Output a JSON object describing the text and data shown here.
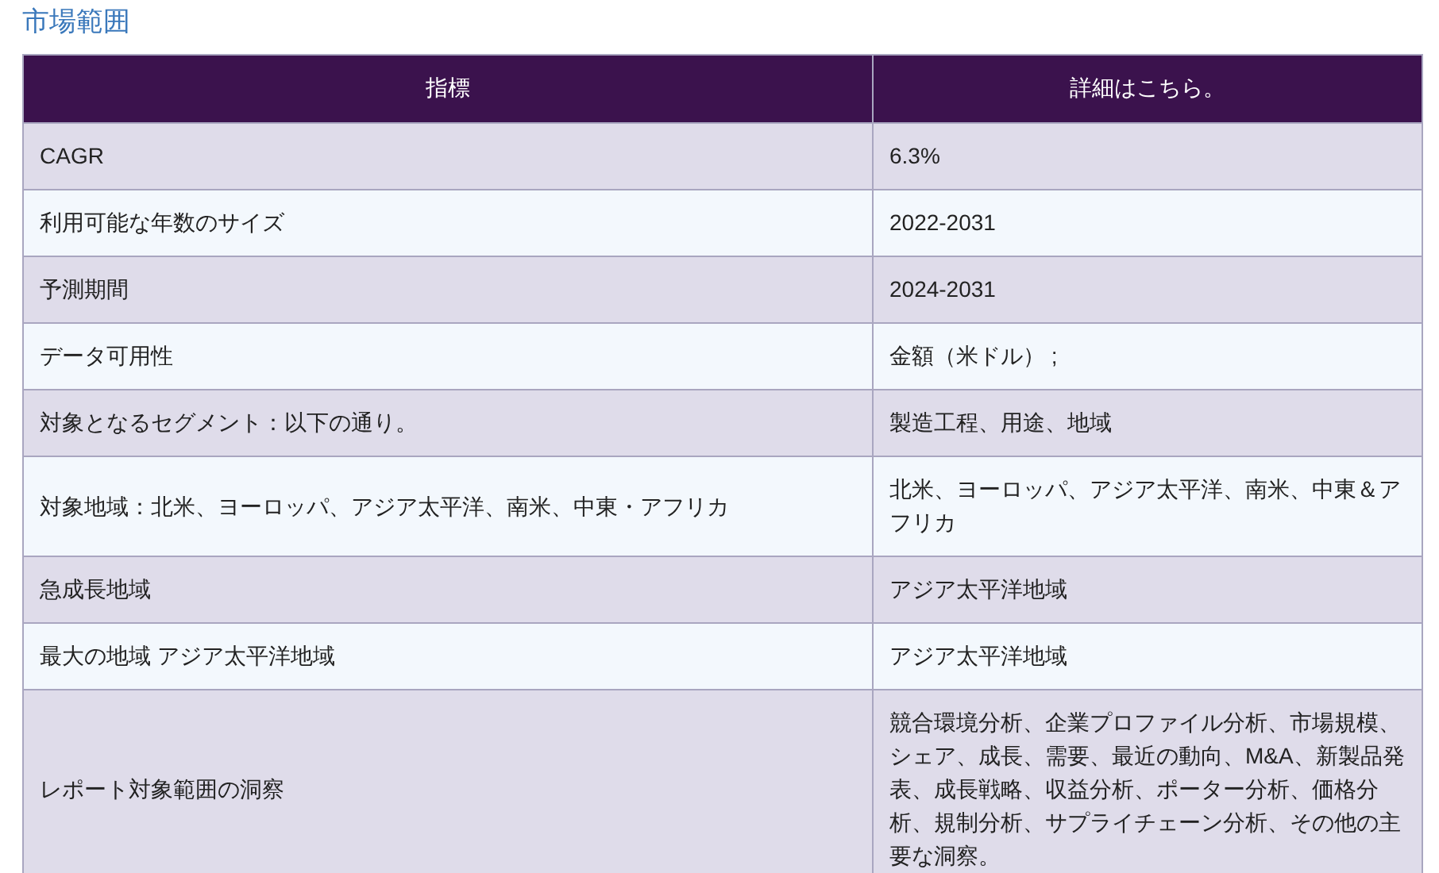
{
  "title": "市場範囲",
  "table": {
    "columns": [
      "指標",
      "詳細はこちら。"
    ],
    "rows": [
      [
        "CAGR",
        "6.3%"
      ],
      [
        "利用可能な年数のサイズ",
        "2022-2031"
      ],
      [
        "予測期間",
        "2024-2031"
      ],
      [
        "データ可用性",
        "金額（米ドル） ;"
      ],
      [
        "対象となるセグメント：以下の通り。",
        "製造工程、用途、地域"
      ],
      [
        "対象地域：北米、ヨーロッパ、アジア太平洋、南米、中東・アフリカ",
        "北米、ヨーロッパ、アジア太平洋、南米、中東＆アフリカ"
      ],
      [
        "急成長地域",
        "アジア太平洋地域"
      ],
      [
        "最大の地域 アジア太平洋地域",
        "アジア太平洋地域"
      ],
      [
        "レポート対象範囲の洞察",
        "競合環境分析、企業プロファイル分析、市場規模、シェア、成長、需要、最近の動向、M&A、新製品発表、成長戦略、収益分析、ポーター分析、価格分析、規制分析、サプライチェーン分析、その他の主要な洞察。"
      ]
    ]
  }
}
